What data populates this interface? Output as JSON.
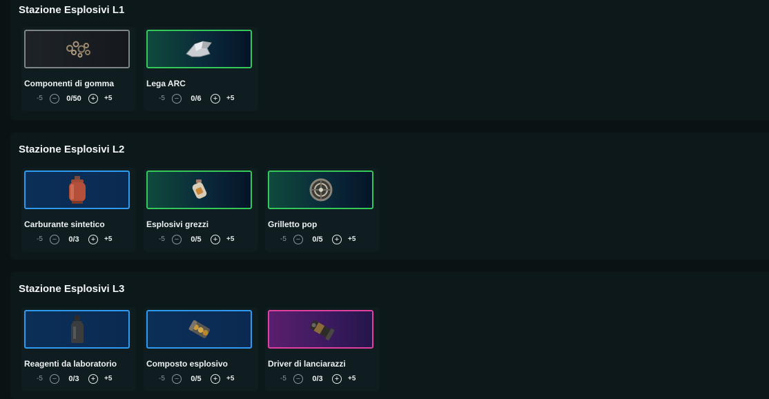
{
  "sections": [
    {
      "title": "Stazione Esplosivi L1",
      "items": [
        {
          "name": "Componenti di gomma",
          "count": "0/50",
          "minus_label": "-5",
          "plus_label": "+5",
          "rarity": "common",
          "icon": "rubber-parts-icon"
        },
        {
          "name": "Lega ARC",
          "count": "0/6",
          "minus_label": "-5",
          "plus_label": "+5",
          "rarity": "uncommon",
          "icon": "arc-alloy-icon"
        }
      ]
    },
    {
      "title": "Stazione Esplosivi L2",
      "items": [
        {
          "name": "Carburante sintetico",
          "count": "0/3",
          "minus_label": "-5",
          "plus_label": "+5",
          "rarity": "rare",
          "icon": "gas-canister-icon"
        },
        {
          "name": "Esplosivi grezzi",
          "count": "0/5",
          "minus_label": "-5",
          "plus_label": "+5",
          "rarity": "uncommon",
          "icon": "bottle-icon"
        },
        {
          "name": "Grilletto pop",
          "count": "0/5",
          "minus_label": "-5",
          "plus_label": "+5",
          "rarity": "uncommon",
          "icon": "pop-trigger-icon"
        }
      ]
    },
    {
      "title": "Stazione Esplosivi L3",
      "items": [
        {
          "name": "Reagenti da laboratorio",
          "count": "0/3",
          "minus_label": "-5",
          "plus_label": "+5",
          "rarity": "rare",
          "icon": "reagent-bottle-icon"
        },
        {
          "name": "Composto esplosivo",
          "count": "0/5",
          "minus_label": "-5",
          "plus_label": "+5",
          "rarity": "rare",
          "icon": "explosive-compound-icon"
        },
        {
          "name": "Driver di lanciarazzi",
          "count": "0/3",
          "minus_label": "-5",
          "plus_label": "+5",
          "rarity": "epic",
          "icon": "rocket-driver-icon"
        }
      ]
    }
  ],
  "colors": {
    "common": "#7f8488",
    "uncommon": "#34c759",
    "rare": "#2e9bf0",
    "epic": "#e040a0"
  }
}
